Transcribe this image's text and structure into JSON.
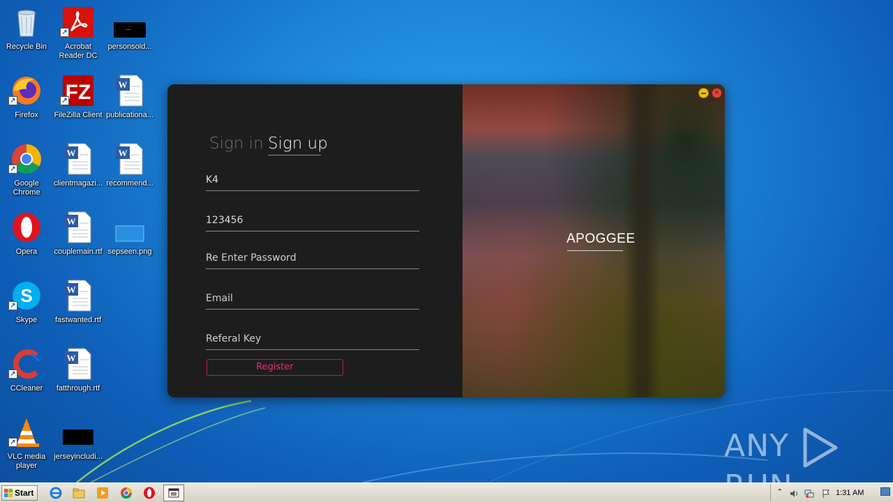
{
  "desktop": {
    "icons": [
      {
        "label": "Recycle Bin",
        "icon": "recycle-bin-icon"
      },
      {
        "label": "Acrobat Reader DC",
        "icon": "acrobat-icon"
      },
      {
        "label": "personsold...",
        "icon": "black-file-icon"
      },
      {
        "label": "Firefox",
        "icon": "firefox-icon"
      },
      {
        "label": "FileZilla Client",
        "icon": "filezilla-icon"
      },
      {
        "label": "publicationa...",
        "icon": "word-doc-icon"
      },
      {
        "label": "Google Chrome",
        "icon": "chrome-icon"
      },
      {
        "label": "clientmagazi...",
        "icon": "word-doc-icon"
      },
      {
        "label": "recommend...",
        "icon": "word-doc-icon"
      },
      {
        "label": "Opera",
        "icon": "opera-icon"
      },
      {
        "label": "couplemain.rtf",
        "icon": "word-doc-icon"
      },
      {
        "label": "sepseen.png",
        "icon": "png-file-icon"
      },
      {
        "label": "Skype",
        "icon": "skype-icon"
      },
      {
        "label": "fastwanted.rtf",
        "icon": "word-doc-icon"
      },
      {
        "label": "CCleaner",
        "icon": "ccleaner-icon"
      },
      {
        "label": "fatthrough.rtf",
        "icon": "word-doc-icon"
      },
      {
        "label": "VLC media player",
        "icon": "vlc-icon"
      },
      {
        "label": "jerseyincludi...",
        "icon": "black-file-icon"
      }
    ]
  },
  "app": {
    "tabs": {
      "signin": "Sign in",
      "signup": "Sign up"
    },
    "fields": {
      "username": {
        "value": "K4",
        "placeholder": ""
      },
      "password": {
        "value": "123456",
        "placeholder": ""
      },
      "reenter": {
        "value": "",
        "placeholder": "Re Enter Password"
      },
      "email": {
        "value": "",
        "placeholder": "Email"
      },
      "referal": {
        "value": "",
        "placeholder": "Referal Key"
      }
    },
    "register_label": "Register",
    "brand": "APOGGEE",
    "accent_color": "#e1307a"
  },
  "watermark": {
    "left": "ANY",
    "right": "RUN"
  },
  "taskbar": {
    "start_label": "Start",
    "clock": "1:31 AM"
  }
}
